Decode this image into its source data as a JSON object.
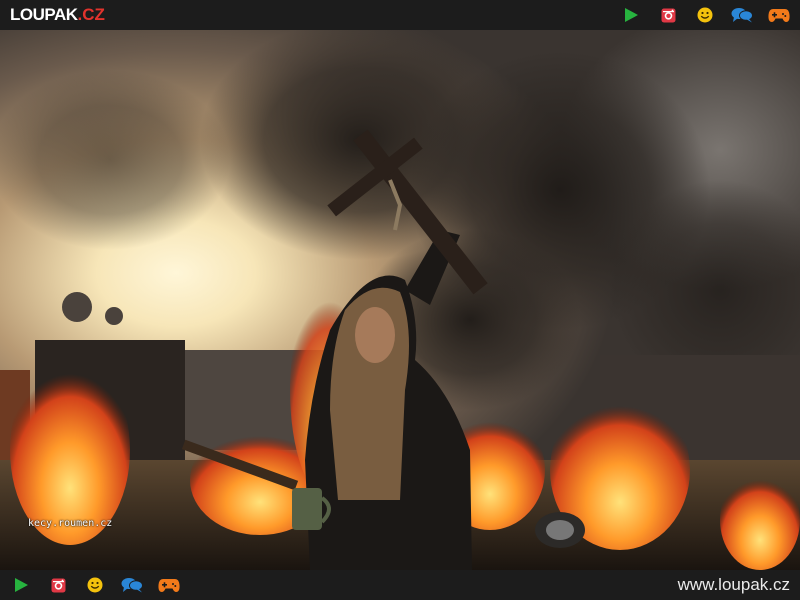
{
  "header": {
    "logo_main": "LOUPAK",
    "logo_tld": ".CZ",
    "icons": [
      "play-icon",
      "instagram-icon",
      "smiley-icon",
      "chat-icon",
      "gamepad-icon"
    ]
  },
  "photo": {
    "watermark": "kecy.roumen.cz"
  },
  "footer": {
    "site_url": "www.loupak.cz",
    "icons": [
      "play-icon",
      "instagram-icon",
      "smiley-icon",
      "chat-icon",
      "gamepad-icon"
    ]
  },
  "colors": {
    "bar_bg": "#1c1c1c",
    "play": "#27b33f",
    "instagram": "#e03845",
    "smiley": "#f4c20d",
    "chat": "#2a86d6",
    "gamepad": "#f27a1a",
    "logo_accent": "#e2332d"
  }
}
